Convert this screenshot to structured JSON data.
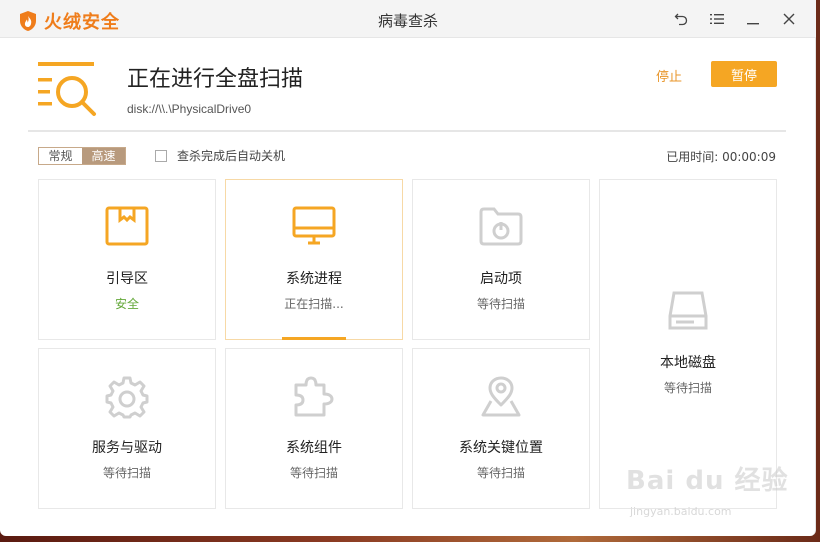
{
  "app": {
    "logo_text": "火绒安全",
    "window_title": "病毒查杀"
  },
  "scan": {
    "title": "正在进行全盘扫描",
    "path": "disk://\\\\.\\PhysicalDrive0",
    "stop_label": "停止",
    "pause_label": "暂停"
  },
  "options": {
    "mode_normal": "常规",
    "mode_fast": "高速",
    "selected_mode": "高速",
    "auto_shutdown_label": "查杀完成后自动关机",
    "auto_shutdown_checked": false,
    "elapsed_label": "已用时间:",
    "elapsed_value": "00:00:09"
  },
  "cards": [
    {
      "name": "引导区",
      "status": "安全",
      "icon": "boot-sector-icon"
    },
    {
      "name": "系统进程",
      "status": "正在扫描...",
      "icon": "monitor-icon"
    },
    {
      "name": "启动项",
      "status": "等待扫描",
      "icon": "startup-folder-icon"
    },
    {
      "name": "本地磁盘",
      "status": "等待扫描",
      "icon": "hard-disk-icon"
    },
    {
      "name": "服务与驱动",
      "status": "等待扫描",
      "icon": "gear-icon"
    },
    {
      "name": "系统组件",
      "status": "等待扫描",
      "icon": "puzzle-icon"
    },
    {
      "name": "系统关键位置",
      "status": "等待扫描",
      "icon": "location-pin-icon"
    }
  ],
  "colors": {
    "accent": "#f5a623",
    "brand": "#ef7d1b",
    "safe": "#64a83a",
    "inactive_icon": "#cfcfcf"
  },
  "watermark": {
    "text": "Bai du 经验",
    "sub": "jingyan.baidu.com"
  }
}
